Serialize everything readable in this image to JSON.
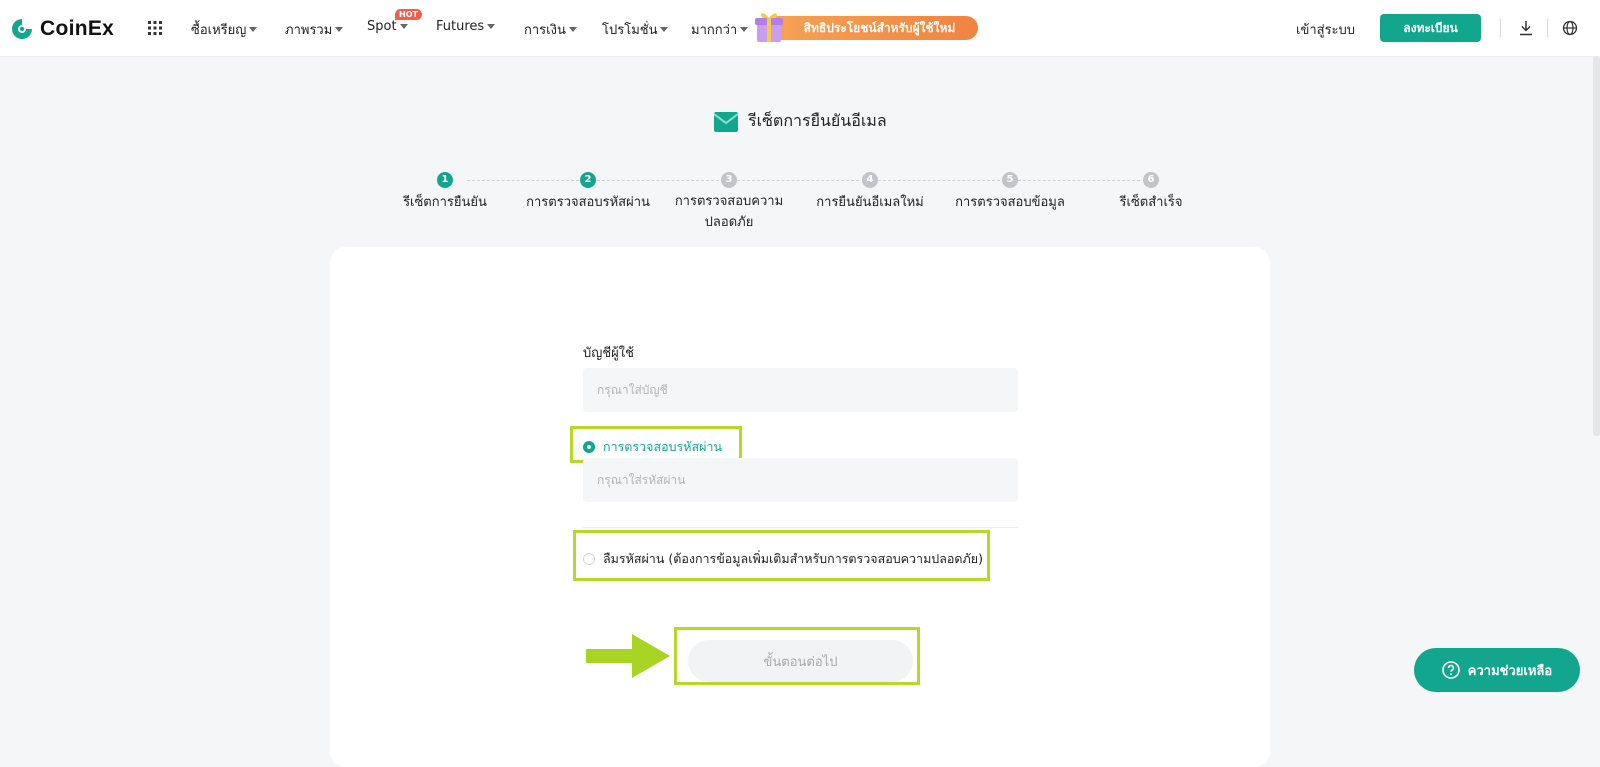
{
  "brand": {
    "name": "CoinEx",
    "accent": "#12a68f",
    "highlight": "#b8d827",
    "promo_color": "#f08440"
  },
  "nav": {
    "items": [
      {
        "label": "ซื้อเหรียญ",
        "has_caret": true
      },
      {
        "label": "ภาพรวม",
        "has_caret": true
      },
      {
        "label": "Spot",
        "has_caret": true,
        "badge": "HOT"
      },
      {
        "label": "Futures",
        "has_caret": true
      },
      {
        "label": "การเงิน",
        "has_caret": true
      },
      {
        "label": "โปรโมชั่น",
        "has_caret": true
      },
      {
        "label": "มากกว่า",
        "has_caret": true
      }
    ],
    "promo": "สิทธิประโยชน์สำหรับผู้ใช้ใหม่",
    "login": "เข้าสู่ระบบ",
    "register": "ลงทะเบียน",
    "icons": [
      "apps-grid-icon",
      "download-icon",
      "globe-icon"
    ]
  },
  "page": {
    "title": "รีเซ็ตการยืนยันอีเมล",
    "steps": [
      {
        "num": "1",
        "label": "รีเซ็ตการยืนยัน",
        "active": true
      },
      {
        "num": "2",
        "label": "การตรวจสอบรหัสผ่าน",
        "active": true
      },
      {
        "num": "3",
        "label": "การตรวจสอบความปลอดภัย",
        "active": false
      },
      {
        "num": "4",
        "label": "การยืนยันอีเมลใหม่",
        "active": false
      },
      {
        "num": "5",
        "label": "การตรวจสอบข้อมูล",
        "active": false
      },
      {
        "num": "6",
        "label": "รีเซ็ตสำเร็จ",
        "active": false
      }
    ]
  },
  "form": {
    "account_label": "บัญชีผู้ใช้",
    "account_placeholder": "กรุณาใส่บัญชี",
    "account_value": "",
    "option_password": "การตรวจสอบรหัสผ่าน",
    "option_password_selected": true,
    "password_placeholder": "กรุณาใส่รหัสผ่าน",
    "password_value": "",
    "option_forgot": "ลืมรหัสผ่าน (ต้องการข้อมูลเพิ่มเติมสำหรับการตรวจสอบความปลอดภัย)",
    "option_forgot_selected": false,
    "next_button": "ขั้นตอนต่อไป"
  },
  "help": {
    "label": "ความช่วยเหลือ"
  }
}
